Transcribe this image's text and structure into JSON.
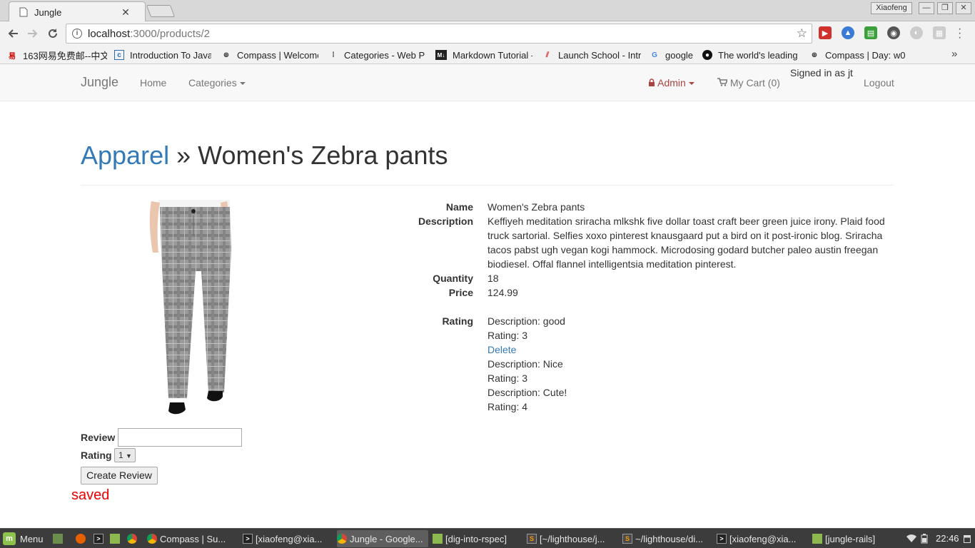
{
  "browser": {
    "tab_title": "Jungle",
    "profile_name": "Xiaofeng",
    "url_host": "localhost",
    "url_path": ":3000/products/2",
    "bookmarks": [
      {
        "label": "163网易免费邮--中文",
        "icon": "163-icon",
        "color": "#c00"
      },
      {
        "label": "Introduction To Java",
        "icon": "c-icon",
        "color": "#2a6db5"
      },
      {
        "label": "Compass | Welcome",
        "icon": "compass-icon",
        "color": "#333"
      },
      {
        "label": "Categories - Web Pr",
        "icon": "web-icon",
        "color": "#333"
      },
      {
        "label": "Markdown Tutorial -",
        "icon": "markdown-icon",
        "color": "#222"
      },
      {
        "label": "Launch School - Intr",
        "icon": "launch-school-icon",
        "color": "#d33"
      },
      {
        "label": "google",
        "icon": "google-icon",
        "color": "#4285f4"
      },
      {
        "label": "The world's leading",
        "icon": "github-icon",
        "color": "#111"
      },
      {
        "label": "Compass | Day: w0",
        "icon": "compass-icon",
        "color": "#333"
      }
    ]
  },
  "nav": {
    "brand": "Jungle",
    "home": "Home",
    "categories": "Categories",
    "admin": "Admin",
    "cart": "My Cart (0)",
    "signed_in": "Signed in as jt",
    "logout": "Logout"
  },
  "page": {
    "crumb": "Apparel",
    "separator": " » ",
    "title": "Women's Zebra pants"
  },
  "product": {
    "name_label": "Name",
    "name": "Women's Zebra pants",
    "description_label": "Description",
    "description": "Keffiyeh meditation sriracha mlkshk five dollar toast craft beer green juice irony. Plaid food truck sartorial. Selfies xoxo pinterest knausgaard put a bird on it post-ironic blog. Sriracha tacos pabst ugh vegan kogi hammock. Microdosing godard butcher paleo austin freegan biodiesel. Offal flannel intelligentsia meditation pinterest.",
    "quantity_label": "Quantity",
    "quantity": "18",
    "price_label": "Price",
    "price": "124.99",
    "rating_label": "Rating",
    "reviews": [
      {
        "description": "Description: good",
        "rating": "Rating: 3",
        "delete": "Delete"
      },
      {
        "description": "Description: Nice",
        "rating": "Rating: 3"
      },
      {
        "description": "Description: Cute!",
        "rating": "Rating: 4"
      }
    ]
  },
  "form": {
    "review_label": "Review",
    "review_value": "",
    "rating_label": "Rating",
    "rating_value": "1",
    "submit": "Create Review",
    "flash": "saved"
  },
  "taskbar": {
    "menu": "Menu",
    "windows": [
      {
        "label": "Compass | Su...",
        "icon": "chrome-icon"
      },
      {
        "label": "[xiaofeng@xia...",
        "icon": "terminal-icon"
      },
      {
        "label": "Jungle - Google...",
        "icon": "chrome-icon",
        "active": true
      },
      {
        "label": "[dig-into-rspec]",
        "icon": "folder-icon"
      },
      {
        "label": "[~/lighthouse/j...",
        "icon": "sublime-icon"
      },
      {
        "label": "~/lighthouse/di...",
        "icon": "sublime-icon"
      },
      {
        "label": "[xiaofeng@xia...",
        "icon": "terminal-icon"
      },
      {
        "label": "[jungle-rails]",
        "icon": "folder-icon"
      }
    ],
    "clock": "22:46"
  }
}
